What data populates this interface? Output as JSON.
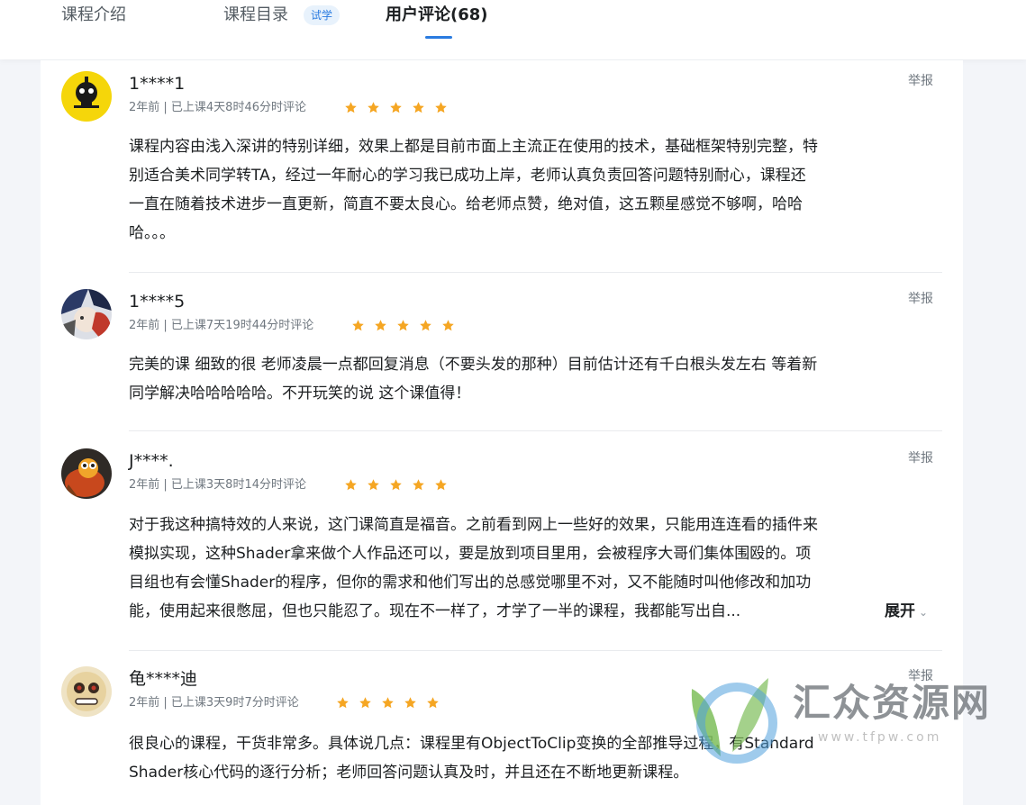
{
  "tabs": {
    "intro": "课程介绍",
    "catalog": "课程目录",
    "catalog_badge": "试学",
    "reviews": "用户评论(68)"
  },
  "reviews": [
    {
      "username": "1****1",
      "meta": "2年前 | 已上课4天8时46分时评论",
      "rating": 5,
      "report": "举报",
      "content_lines": [
        "课程内容由浅入深讲的特别详细，效果上都是目前市面上主流正在使用的技术，基础框架特别完整，特",
        "别适合美术同学转TA，经过一年耐心的学习我已成功上岸，老师认真负责回答问题特别耐心，课程还",
        "一直在随着技术进步一直更新，简直不要太良心。给老师点赞，绝对值，这五颗星感觉不够啊，哈哈",
        "哈。。。"
      ]
    },
    {
      "username": "1****5",
      "meta": "2年前 | 已上课7天19时44分时评论",
      "rating": 5,
      "report": "举报",
      "content_lines": [
        "完美的课 细致的很 老师凌晨一点都回复消息（不要头发的那种）目前估计还有千白根头发左右 等着新",
        "同学解决哈哈哈哈哈。不开玩笑的说 这个课值得！"
      ]
    },
    {
      "username": "J****.",
      "meta": "2年前 | 已上课3天8时14分时评论",
      "rating": 5,
      "report": "举报",
      "content_lines": [
        "对于我这种搞特效的人来说，这门课简直是福音。之前看到网上一些好的效果，只能用连连看的插件来",
        "模拟实现，这种Shader拿来做个人作品还可以，要是放到项目里用，会被程序大哥们集体围殴的。项",
        "目组也有会懂Shader的程序，但你的需求和他们写出的总感觉哪里不对，又不能随时叫他修改和加功",
        "能，使用起来很憋屈，但也只能忍了。现在不一样了，才学了一半的课程，我都能写出自..."
      ],
      "expand_label": "展开"
    },
    {
      "username": "龟****迪",
      "meta": "2年前 | 已上课3天9时7分时评论",
      "rating": 5,
      "report": "举报",
      "content_lines": [
        "很良心的课程，干货非常多。具体说几点：课程里有ObjectToClip变换的全部推导过程，有Standard",
        "Shader核心代码的逐行分析；老师回答问题认真及时，并且还在不断地更新课程。"
      ]
    }
  ],
  "watermark": {
    "text": "汇众资源网",
    "url": "www.tfpw.com"
  },
  "colors": {
    "accent": "#2a7be0",
    "star": "#f5a623",
    "text": "#1c1f21",
    "muted": "#707880"
  }
}
